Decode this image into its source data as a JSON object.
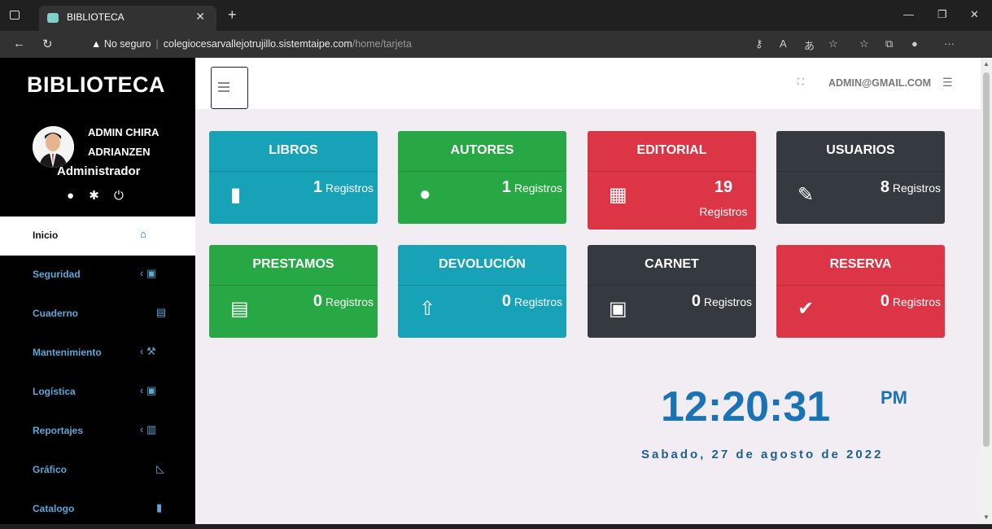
{
  "browser": {
    "tab_title": "BIBLIOTECA",
    "security": "No seguro",
    "url_host": "colegiocesarvallejotrujillo.sistemtaipe.com",
    "url_path": "/home/tarjeta"
  },
  "sidebar": {
    "brand": "BIBLIOTECA",
    "user_line1": "ADMIN CHIRA",
    "user_line2": "ADRIANZEN",
    "role": "Administrador",
    "items": [
      {
        "label": "Inicio",
        "icon": "home-icon",
        "glyph": "🏠"
      },
      {
        "label": "Seguridad",
        "icon": "clipboard-icon",
        "glyph": "‹ 📋"
      },
      {
        "label": "Cuaderno",
        "icon": "id-card-icon",
        "glyph": "🪪"
      },
      {
        "label": "Mantenimiento",
        "icon": "wrench-icon",
        "glyph": "‹ 🔧"
      },
      {
        "label": "Logística",
        "icon": "clipboard-icon",
        "glyph": "‹ 📋"
      },
      {
        "label": "Reportajes",
        "icon": "bar-chart-icon",
        "glyph": "‹ 📊"
      },
      {
        "label": "Gráfico",
        "icon": "area-chart-icon",
        "glyph": "📈"
      },
      {
        "label": "Catalogo",
        "icon": "book-reader-icon",
        "glyph": "📖"
      }
    ]
  },
  "header": {
    "admin_email": "ADMIN@GMAIL.COM"
  },
  "cards": [
    {
      "title": "LIBROS",
      "count": "1",
      "unit": "Registros",
      "icon": "book-icon",
      "glyph": "📕",
      "color": "#17a2b8"
    },
    {
      "title": "AUTORES",
      "count": "1",
      "unit": "Registros",
      "icon": "user-icon",
      "glyph": "👤",
      "color": "#28a745"
    },
    {
      "title": "EDITORIAL",
      "count": "19",
      "unit": "Registros",
      "icon": "building-icon",
      "glyph": "🏢",
      "color": "#dc3545"
    },
    {
      "title": "USUARIOS",
      "count": "8",
      "unit": "Registros",
      "icon": "user-edit-icon",
      "glyph": "👤",
      "color": "#343a40"
    },
    {
      "title": "PRESTAMOS",
      "count": "0",
      "unit": "Registros",
      "icon": "clipboard-list-icon",
      "glyph": "📋",
      "color": "#28a745"
    },
    {
      "title": "DEVOLUCIÓN",
      "count": "0",
      "unit": "Registros",
      "icon": "folder-upload-icon",
      "glyph": "📁",
      "color": "#17a2b8"
    },
    {
      "title": "CARNET",
      "count": "0",
      "unit": "Registros",
      "icon": "id-card-icon",
      "glyph": "🪪",
      "color": "#343a40"
    },
    {
      "title": "RESERVA",
      "count": "0",
      "unit": "Registros",
      "icon": "briefcase-check-icon",
      "glyph": "💼",
      "color": "#dc3545"
    }
  ],
  "clock": {
    "time": "12:20:31",
    "ampm": "PM",
    "date": "Sabado, 27 de agosto de 2022"
  }
}
